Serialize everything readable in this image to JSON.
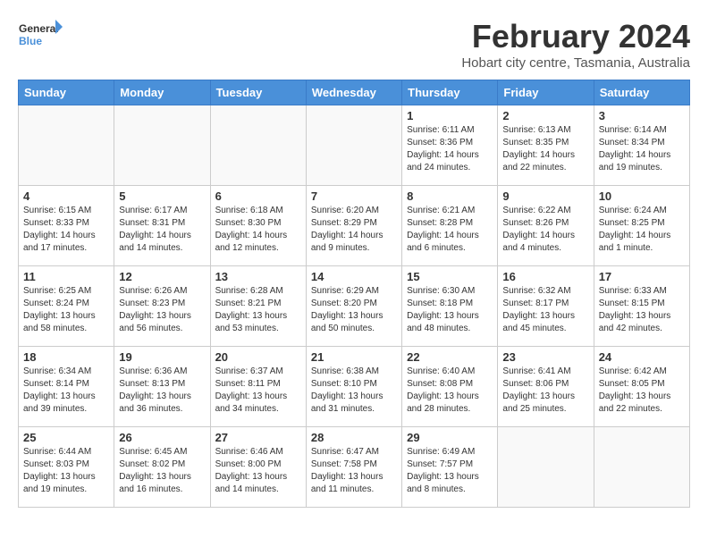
{
  "header": {
    "logo": {
      "general": "General",
      "blue": "Blue"
    },
    "title": "February 2024",
    "location": "Hobart city centre, Tasmania, Australia"
  },
  "calendar": {
    "days_of_week": [
      "Sunday",
      "Monday",
      "Tuesday",
      "Wednesday",
      "Thursday",
      "Friday",
      "Saturday"
    ],
    "weeks": [
      [
        {
          "day": "",
          "info": ""
        },
        {
          "day": "",
          "info": ""
        },
        {
          "day": "",
          "info": ""
        },
        {
          "day": "",
          "info": ""
        },
        {
          "day": "1",
          "info": "Sunrise: 6:11 AM\nSunset: 8:36 PM\nDaylight: 14 hours\nand 24 minutes."
        },
        {
          "day": "2",
          "info": "Sunrise: 6:13 AM\nSunset: 8:35 PM\nDaylight: 14 hours\nand 22 minutes."
        },
        {
          "day": "3",
          "info": "Sunrise: 6:14 AM\nSunset: 8:34 PM\nDaylight: 14 hours\nand 19 minutes."
        }
      ],
      [
        {
          "day": "4",
          "info": "Sunrise: 6:15 AM\nSunset: 8:33 PM\nDaylight: 14 hours\nand 17 minutes."
        },
        {
          "day": "5",
          "info": "Sunrise: 6:17 AM\nSunset: 8:31 PM\nDaylight: 14 hours\nand 14 minutes."
        },
        {
          "day": "6",
          "info": "Sunrise: 6:18 AM\nSunset: 8:30 PM\nDaylight: 14 hours\nand 12 minutes."
        },
        {
          "day": "7",
          "info": "Sunrise: 6:20 AM\nSunset: 8:29 PM\nDaylight: 14 hours\nand 9 minutes."
        },
        {
          "day": "8",
          "info": "Sunrise: 6:21 AM\nSunset: 8:28 PM\nDaylight: 14 hours\nand 6 minutes."
        },
        {
          "day": "9",
          "info": "Sunrise: 6:22 AM\nSunset: 8:26 PM\nDaylight: 14 hours\nand 4 minutes."
        },
        {
          "day": "10",
          "info": "Sunrise: 6:24 AM\nSunset: 8:25 PM\nDaylight: 14 hours\nand 1 minute."
        }
      ],
      [
        {
          "day": "11",
          "info": "Sunrise: 6:25 AM\nSunset: 8:24 PM\nDaylight: 13 hours\nand 58 minutes."
        },
        {
          "day": "12",
          "info": "Sunrise: 6:26 AM\nSunset: 8:23 PM\nDaylight: 13 hours\nand 56 minutes."
        },
        {
          "day": "13",
          "info": "Sunrise: 6:28 AM\nSunset: 8:21 PM\nDaylight: 13 hours\nand 53 minutes."
        },
        {
          "day": "14",
          "info": "Sunrise: 6:29 AM\nSunset: 8:20 PM\nDaylight: 13 hours\nand 50 minutes."
        },
        {
          "day": "15",
          "info": "Sunrise: 6:30 AM\nSunset: 8:18 PM\nDaylight: 13 hours\nand 48 minutes."
        },
        {
          "day": "16",
          "info": "Sunrise: 6:32 AM\nSunset: 8:17 PM\nDaylight: 13 hours\nand 45 minutes."
        },
        {
          "day": "17",
          "info": "Sunrise: 6:33 AM\nSunset: 8:15 PM\nDaylight: 13 hours\nand 42 minutes."
        }
      ],
      [
        {
          "day": "18",
          "info": "Sunrise: 6:34 AM\nSunset: 8:14 PM\nDaylight: 13 hours\nand 39 minutes."
        },
        {
          "day": "19",
          "info": "Sunrise: 6:36 AM\nSunset: 8:13 PM\nDaylight: 13 hours\nand 36 minutes."
        },
        {
          "day": "20",
          "info": "Sunrise: 6:37 AM\nSunset: 8:11 PM\nDaylight: 13 hours\nand 34 minutes."
        },
        {
          "day": "21",
          "info": "Sunrise: 6:38 AM\nSunset: 8:10 PM\nDaylight: 13 hours\nand 31 minutes."
        },
        {
          "day": "22",
          "info": "Sunrise: 6:40 AM\nSunset: 8:08 PM\nDaylight: 13 hours\nand 28 minutes."
        },
        {
          "day": "23",
          "info": "Sunrise: 6:41 AM\nSunset: 8:06 PM\nDaylight: 13 hours\nand 25 minutes."
        },
        {
          "day": "24",
          "info": "Sunrise: 6:42 AM\nSunset: 8:05 PM\nDaylight: 13 hours\nand 22 minutes."
        }
      ],
      [
        {
          "day": "25",
          "info": "Sunrise: 6:44 AM\nSunset: 8:03 PM\nDaylight: 13 hours\nand 19 minutes."
        },
        {
          "day": "26",
          "info": "Sunrise: 6:45 AM\nSunset: 8:02 PM\nDaylight: 13 hours\nand 16 minutes."
        },
        {
          "day": "27",
          "info": "Sunrise: 6:46 AM\nSunset: 8:00 PM\nDaylight: 13 hours\nand 14 minutes."
        },
        {
          "day": "28",
          "info": "Sunrise: 6:47 AM\nSunset: 7:58 PM\nDaylight: 13 hours\nand 11 minutes."
        },
        {
          "day": "29",
          "info": "Sunrise: 6:49 AM\nSunset: 7:57 PM\nDaylight: 13 hours\nand 8 minutes."
        },
        {
          "day": "",
          "info": ""
        },
        {
          "day": "",
          "info": ""
        }
      ]
    ]
  }
}
